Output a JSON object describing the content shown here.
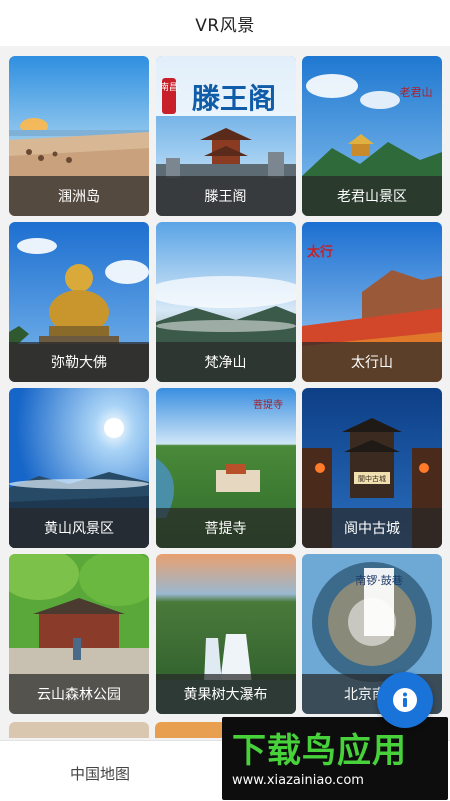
{
  "header": {
    "title": "VR风景"
  },
  "places": [
    {
      "label": "涠洲岛",
      "icon": "beach-photo"
    },
    {
      "label": "滕王阁",
      "icon": "pavilion-photo",
      "sign_text": "滕王阁",
      "sign_badge": "南昌"
    },
    {
      "label": "老君山景区",
      "icon": "mountain-temple-photo",
      "sign_text": "老君山"
    },
    {
      "label": "弥勒大佛",
      "icon": "buddha-statue-photo"
    },
    {
      "label": "梵净山",
      "icon": "sea-of-clouds-photo"
    },
    {
      "label": "太行山",
      "icon": "autumn-mountain-photo",
      "sign_text": "太行"
    },
    {
      "label": "黄山风景区",
      "icon": "sunburst-mountain-photo"
    },
    {
      "label": "菩提寺",
      "icon": "temple-aerial-photo",
      "sign_text": "菩提寺"
    },
    {
      "label": "阆中古城",
      "icon": "ancient-town-photo",
      "sign_text": "閬中古城"
    },
    {
      "label": "云山森林公园",
      "icon": "forest-gate-photo"
    },
    {
      "label": "黄果树大瀑布",
      "icon": "waterfall-photo"
    },
    {
      "label": "北京南锣",
      "icon": "tiny-planet-photo",
      "sign_text": "南锣·鼓巷"
    }
  ],
  "bottom_nav": {
    "map_tab": "中国地图"
  },
  "watermark": {
    "logo": "下载鸟应用",
    "url": "www.xiazainiao.com"
  },
  "fab": {
    "icon": "info-icon"
  }
}
